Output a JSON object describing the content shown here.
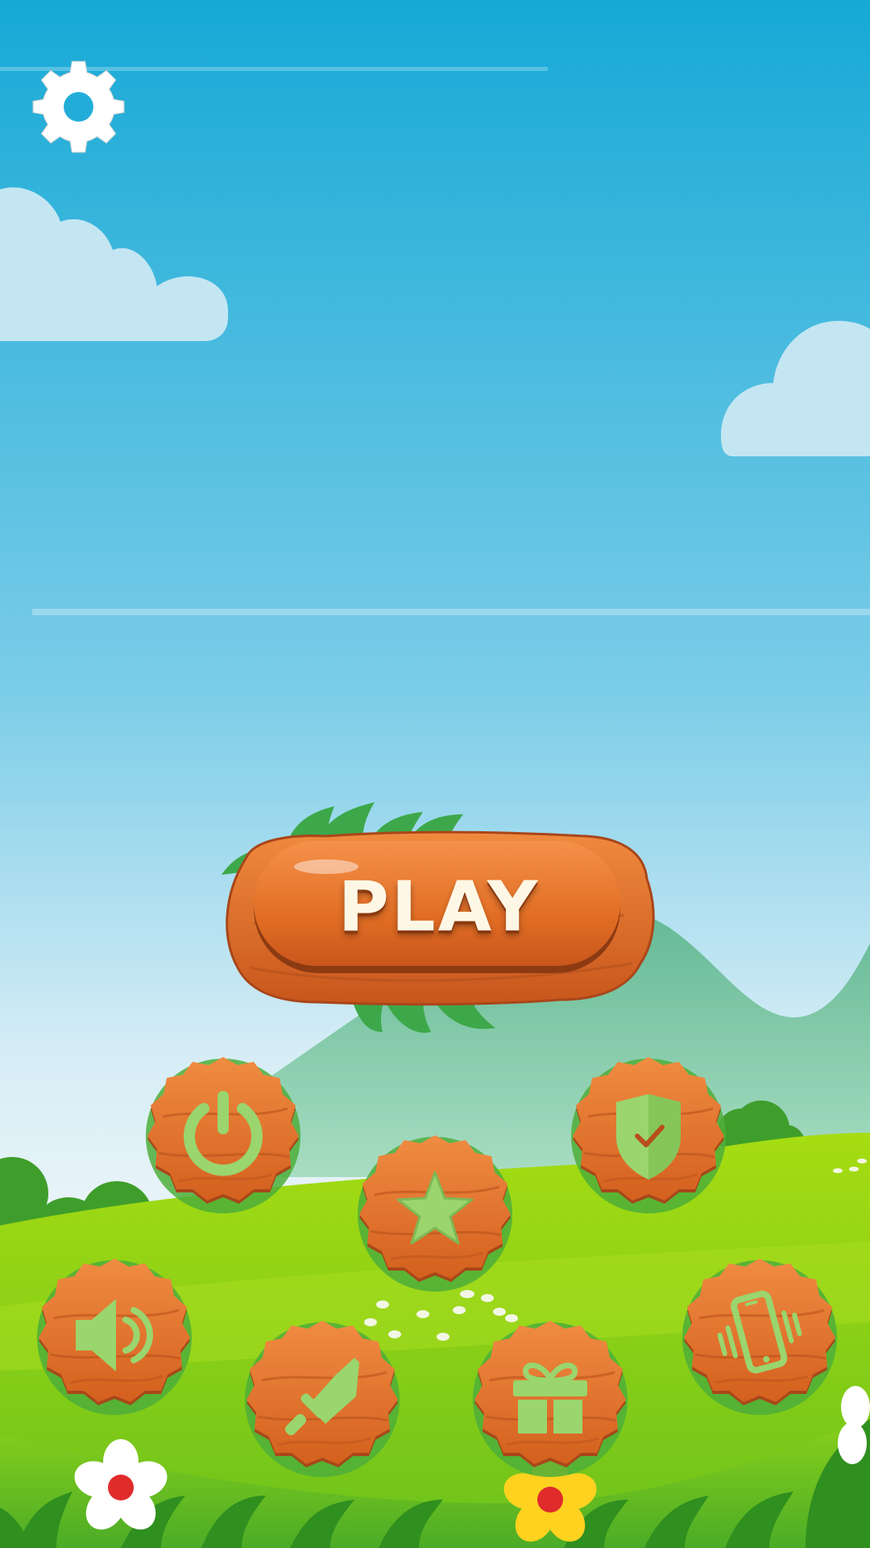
{
  "play_button": {
    "label": "PLAY"
  },
  "icons": {
    "settings": "gear-icon",
    "power": "power-icon",
    "rate": "star-icon",
    "privacy": "shield-check-icon",
    "sound": "speaker-icon",
    "weapons": "sword-icon",
    "gift": "gift-icon",
    "vibration": "phone-vibrate-icon"
  },
  "colors": {
    "sky_top": "#16A9D6",
    "sky_bottom": "#E9F4FA",
    "badge_orange": "#E8742A",
    "badge_dark": "#B8501A",
    "icon_green": "#9AD56E",
    "grass_light": "#9DD80E",
    "grass_dark": "#4CAF2A",
    "mountain": "#7FC7A5"
  }
}
